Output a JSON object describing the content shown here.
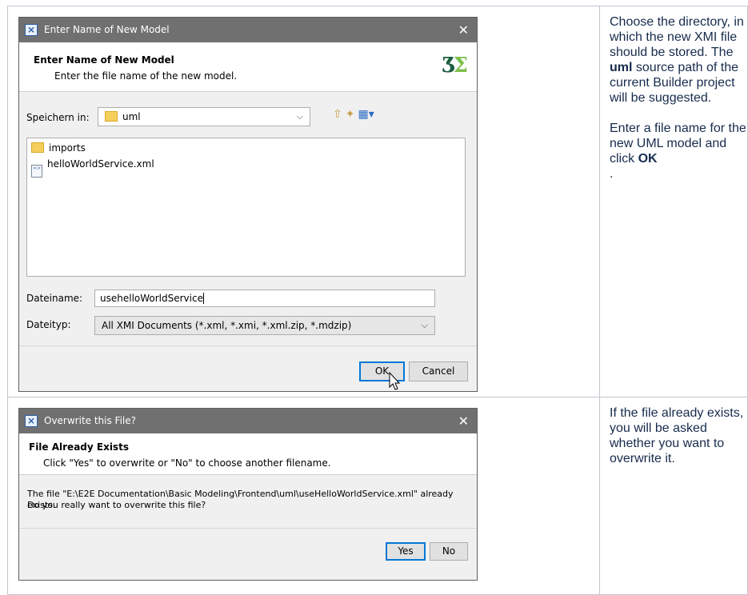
{
  "dialog1": {
    "title": "Enter Name of New Model",
    "banner_title": "Enter Name of New Model",
    "banner_subtitle": "Enter the file name of the new model.",
    "logo_text": "E2E",
    "save_in_label": "Speichern in:",
    "save_in_value": "uml",
    "files": [
      {
        "name": "imports",
        "icon": "folder-icon"
      },
      {
        "name": "helloWorldService.xml",
        "icon": "xml-file-icon"
      }
    ],
    "filename_label": "Dateiname:",
    "filename_value": "usehelloWorldService",
    "filetype_label": "Dateityp:",
    "filetype_value": "All XMI Documents (*.xml, *.xmi, *.xml.zip, *.mdzip)",
    "ok_label": "OK",
    "cancel_label": "Cancel"
  },
  "dialog2": {
    "title": "Overwrite this File?",
    "banner_title": "File Already Exists",
    "banner_subtitle": "Click \"Yes\" to overwrite or \"No\" to choose another filename.",
    "message_line1": "The file \"E:\\E2E Documentation\\Basic Modeling\\Frontend\\uml\\useHelloWorldService.xml\" already exists.",
    "message_line2": "Do you really want to overwrite this file?",
    "yes_label": "Yes",
    "no_label": "No"
  },
  "notes": {
    "row1_p1_a": "Choose the directory, in which the new XMI file should be stored. The",
    "row1_p1_bold": "uml",
    "row1_p1_b": "source path of the current Builder project will be suggested.",
    "row1_p2_a": "Enter a file name for the new UML model and click",
    "row1_p2_bold": "OK",
    "row1_p2_b": ".",
    "row2_p1": "If the file already exists, you will be asked whether you want to overwrite it."
  },
  "colors": {
    "titlebar": "#707070",
    "dialog_bg": "#f0f0f0",
    "default_button_border": "#0078d7",
    "note_text": "#172b4d",
    "table_border": "#c1c7d0"
  }
}
